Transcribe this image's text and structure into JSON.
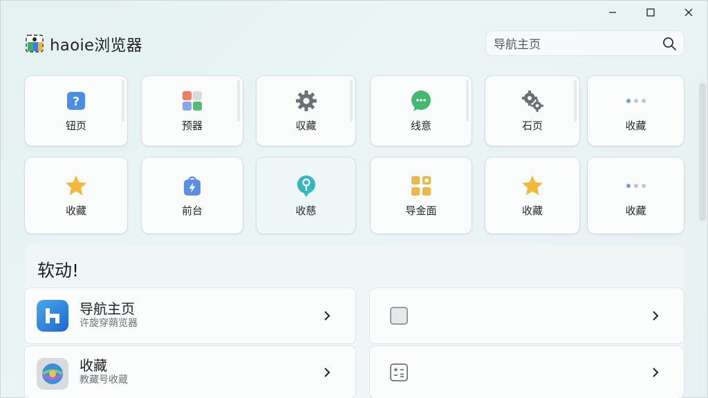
{
  "brand": {
    "title": "haoie浏览器"
  },
  "search": {
    "placeholder": "导航主页"
  },
  "tiles_row1": [
    {
      "label": "钮页",
      "icon": "help-icon"
    },
    {
      "label": "预器",
      "icon": "apps-icon"
    },
    {
      "label": "収藏",
      "icon": "gear-icon"
    },
    {
      "label": "线意",
      "icon": "chat-icon"
    },
    {
      "label": "石页",
      "icon": "puzzle-gear-icon"
    },
    {
      "label": "收藏",
      "icon": "more-icon"
    }
  ],
  "tiles_row2": [
    {
      "label": "收藏",
      "icon": "star-icon"
    },
    {
      "label": "前台",
      "icon": "bolt-bag-icon"
    },
    {
      "label": "收慈",
      "icon": "pin-icon"
    },
    {
      "label": "导金面",
      "icon": "grid-icon"
    },
    {
      "label": "收藏",
      "icon": "star-icon"
    },
    {
      "label": "收藏",
      "icon": "more-icon"
    }
  ],
  "panel": {
    "title": "软动!",
    "cards": [
      {
        "title": "导航主页",
        "subtitle": "许旋穿蒴览器",
        "icon": "haoie-logo-icon"
      },
      {
        "title": "",
        "subtitle": "",
        "icon": "square-icon"
      },
      {
        "title": "收藏",
        "subtitle": "教藏号收蔵",
        "icon": "globe-icon"
      },
      {
        "title": "",
        "subtitle": "",
        "icon": "calc-icon"
      }
    ]
  },
  "colors": {
    "accent": "#3a7be0",
    "star": "#f2b93b",
    "teal": "#35b7c0",
    "green": "#3cb56a"
  }
}
